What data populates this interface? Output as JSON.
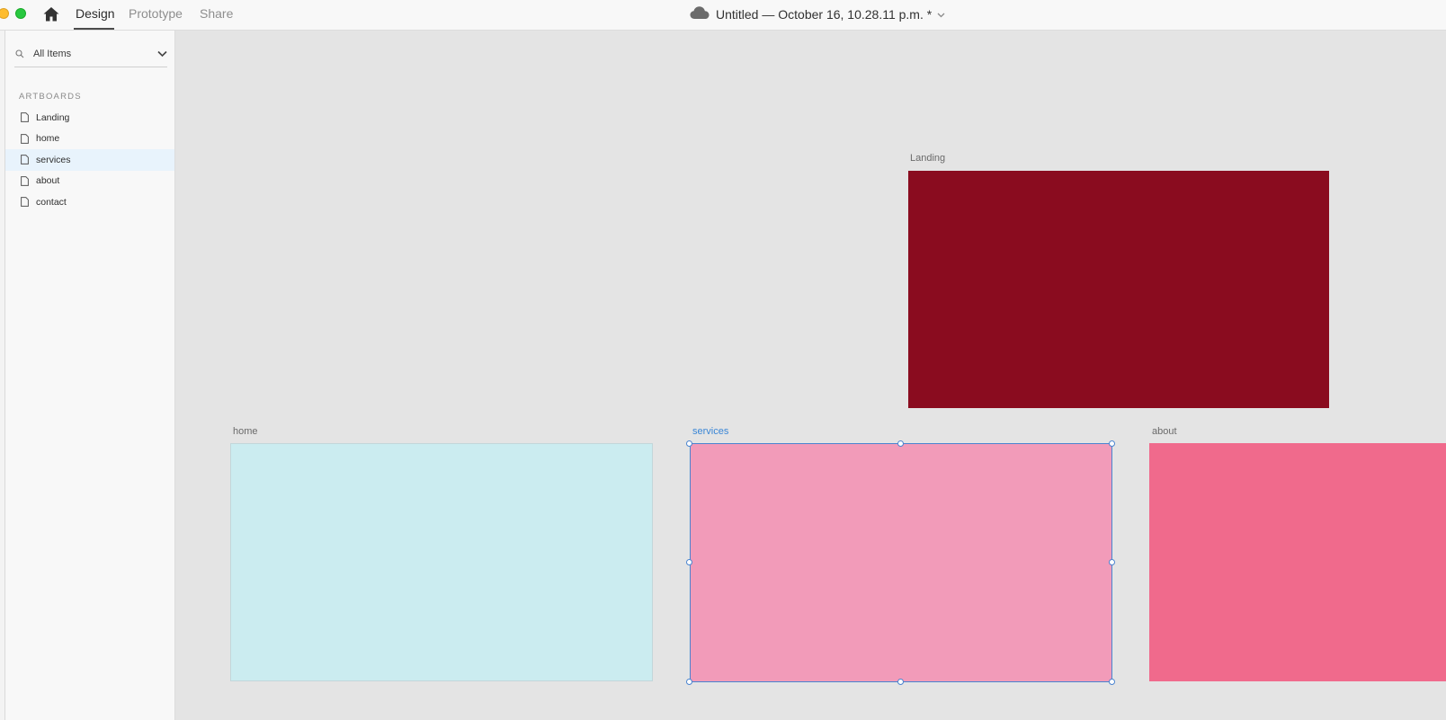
{
  "topbar": {
    "tabs": [
      {
        "label": "Design",
        "active": true
      },
      {
        "label": "Prototype",
        "active": false
      },
      {
        "label": "Share",
        "active": false
      }
    ],
    "doc_title": "Untitled — October 16, 10.28.11 p.m. *",
    "icons": {
      "home": "home-icon",
      "cloud": "cloud-icon",
      "caret": "chevron-down-icon"
    }
  },
  "sidebar": {
    "search_value": "All Items",
    "section_title": "ARTBOARDS",
    "items": [
      {
        "label": "Landing",
        "selected": false
      },
      {
        "label": "home",
        "selected": false
      },
      {
        "label": "services",
        "selected": true
      },
      {
        "label": "about",
        "selected": false
      },
      {
        "label": "contact",
        "selected": false
      }
    ]
  },
  "canvas": {
    "artboards": [
      {
        "label": "Landing",
        "color": "#8a0c1f"
      },
      {
        "label": "home",
        "color": "#cbecf0"
      },
      {
        "label": "services",
        "color": "#f29bb9",
        "selected": true
      },
      {
        "label": "about",
        "color": "#f06a8c"
      }
    ]
  },
  "colors": {
    "accent": "#4a84d0"
  }
}
